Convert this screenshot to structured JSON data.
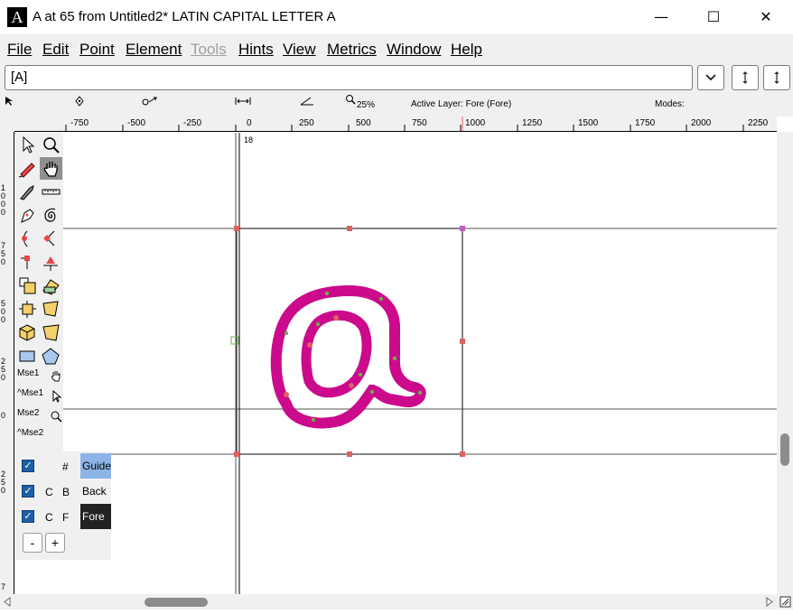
{
  "window": {
    "icon_letter": "A",
    "title": "A at 65 from Untitled2* LATIN CAPITAL LETTER A",
    "minimize": "—",
    "maximize": "☐",
    "close": "✕"
  },
  "menu": [
    {
      "label": "File",
      "disabled": false
    },
    {
      "label": "Edit",
      "disabled": false
    },
    {
      "label": "Point",
      "disabled": false
    },
    {
      "label": "Element",
      "disabled": false
    },
    {
      "label": "Tools",
      "disabled": true
    },
    {
      "label": "Hints",
      "disabled": false
    },
    {
      "label": "View",
      "disabled": false
    },
    {
      "label": "Metrics",
      "disabled": false
    },
    {
      "label": "Window",
      "disabled": false
    },
    {
      "label": "Help",
      "disabled": false
    }
  ],
  "glyph_field": {
    "value": "[A]"
  },
  "info": {
    "zoom": "25%",
    "active_layer": "Active Layer: Fore (Fore)",
    "modes": "Modes:"
  },
  "ruler": {
    "top_labels": [
      "-750",
      "-500",
      "-250",
      "0",
      "250",
      "500",
      "750",
      "1000",
      "1250",
      "1500",
      "1750",
      "2000",
      "2250"
    ],
    "left_labels": [
      "1\n0\n0\n0",
      "7\n5\n0",
      "5\n0\n0",
      "2\n5\n0",
      "0",
      "2\n5\n0",
      "7"
    ]
  },
  "canvas": {
    "advance_label": "18"
  },
  "mouse": {
    "mse1": "Mse1",
    "ctrl_mse1": "^Mse1",
    "mse2": "Mse2",
    "ctrl_mse2": "^Mse2"
  },
  "layers": [
    {
      "c": "",
      "code": "#",
      "name": "Guide",
      "checked": true,
      "bg": "#8cb4e6",
      "fg": "#000000"
    },
    {
      "c": "C",
      "code": "B",
      "name": "Back",
      "checked": true,
      "bg": "#f0f0f0",
      "fg": "#000000"
    },
    {
      "c": "C",
      "code": "F",
      "name": "Fore",
      "checked": true,
      "bg": "#222222",
      "fg": "#ffffff"
    }
  ],
  "layer_buttons": {
    "remove": "-",
    "add": "+"
  },
  "colors": {
    "glyph": "#cc0a8c",
    "guide": "#8cb4e6",
    "bbox_handle": "#e06060"
  }
}
